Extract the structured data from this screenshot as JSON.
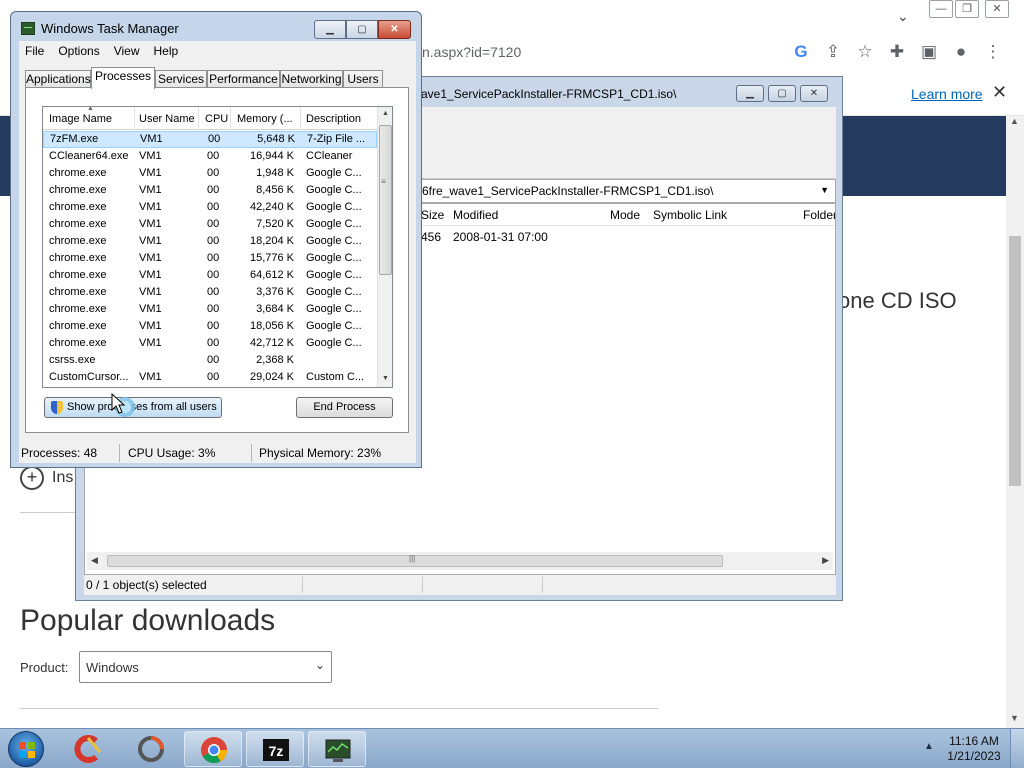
{
  "browser": {
    "url_fragment": "n.aspx?id=7120",
    "learn_more": "Learn more",
    "page_heading_fragment": "one CD ISO",
    "insert_fragment": "Ins",
    "popular_heading": "Popular downloads",
    "product_label": "Product:",
    "product_value": "Windows"
  },
  "sevenzip": {
    "title": "ave1_ServicePackInstaller-FRMCSP1_CD1.iso\\",
    "path": "6fre_wave1_ServicePackInstaller-FRMCSP1_CD1.iso\\",
    "columns": [
      "Size",
      "Modified",
      "Mode",
      "Symbolic Link",
      "Folder"
    ],
    "row": {
      "size": "456",
      "modified": "2008-01-31 07:00"
    },
    "status": "0 / 1 object(s) selected"
  },
  "taskmgr": {
    "title": "Windows Task Manager",
    "menu": [
      "File",
      "Options",
      "View",
      "Help"
    ],
    "tabs": [
      "Applications",
      "Processes",
      "Services",
      "Performance",
      "Networking",
      "Users"
    ],
    "active_tab": "Processes",
    "columns": [
      "Image Name",
      "User Name",
      "CPU",
      "Memory (...",
      "Description"
    ],
    "rows": [
      [
        "7zFM.exe",
        "VM1",
        "00",
        "5,648 K",
        "7-Zip File ..."
      ],
      [
        "CCleaner64.exe",
        "VM1",
        "00",
        "16,944 K",
        "CCleaner"
      ],
      [
        "chrome.exe",
        "VM1",
        "00",
        "1,948 K",
        "Google C..."
      ],
      [
        "chrome.exe",
        "VM1",
        "00",
        "8,456 K",
        "Google C..."
      ],
      [
        "chrome.exe",
        "VM1",
        "00",
        "42,240 K",
        "Google C..."
      ],
      [
        "chrome.exe",
        "VM1",
        "00",
        "7,520 K",
        "Google C..."
      ],
      [
        "chrome.exe",
        "VM1",
        "00",
        "18,204 K",
        "Google C..."
      ],
      [
        "chrome.exe",
        "VM1",
        "00",
        "15,776 K",
        "Google C..."
      ],
      [
        "chrome.exe",
        "VM1",
        "00",
        "64,612 K",
        "Google C..."
      ],
      [
        "chrome.exe",
        "VM1",
        "00",
        "3,376 K",
        "Google C..."
      ],
      [
        "chrome.exe",
        "VM1",
        "00",
        "3,684 K",
        "Google C..."
      ],
      [
        "chrome.exe",
        "VM1",
        "00",
        "18,056 K",
        "Google C..."
      ],
      [
        "chrome.exe",
        "VM1",
        "00",
        "42,712 K",
        "Google C..."
      ],
      [
        "csrss.exe",
        "",
        "00",
        "2,368 K",
        ""
      ],
      [
        "CustomCursor...",
        "VM1",
        "00",
        "29,024 K",
        "Custom C..."
      ]
    ],
    "show_all_button": "Show processes from all users",
    "end_process_button": "End Process",
    "status": {
      "processes": "Processes: 48",
      "cpu": "CPU Usage: 3%",
      "memory": "Physical Memory: 23%"
    }
  },
  "taskbar": {
    "time": "11:16 AM",
    "date": "1/21/2023",
    "items": [
      "ccleaner",
      "customcursor",
      "chrome",
      "7-zip",
      "task-manager"
    ]
  },
  "colors": {
    "hero": "#243a5e",
    "link": "#0067b8",
    "selection": "#cde8ff"
  }
}
